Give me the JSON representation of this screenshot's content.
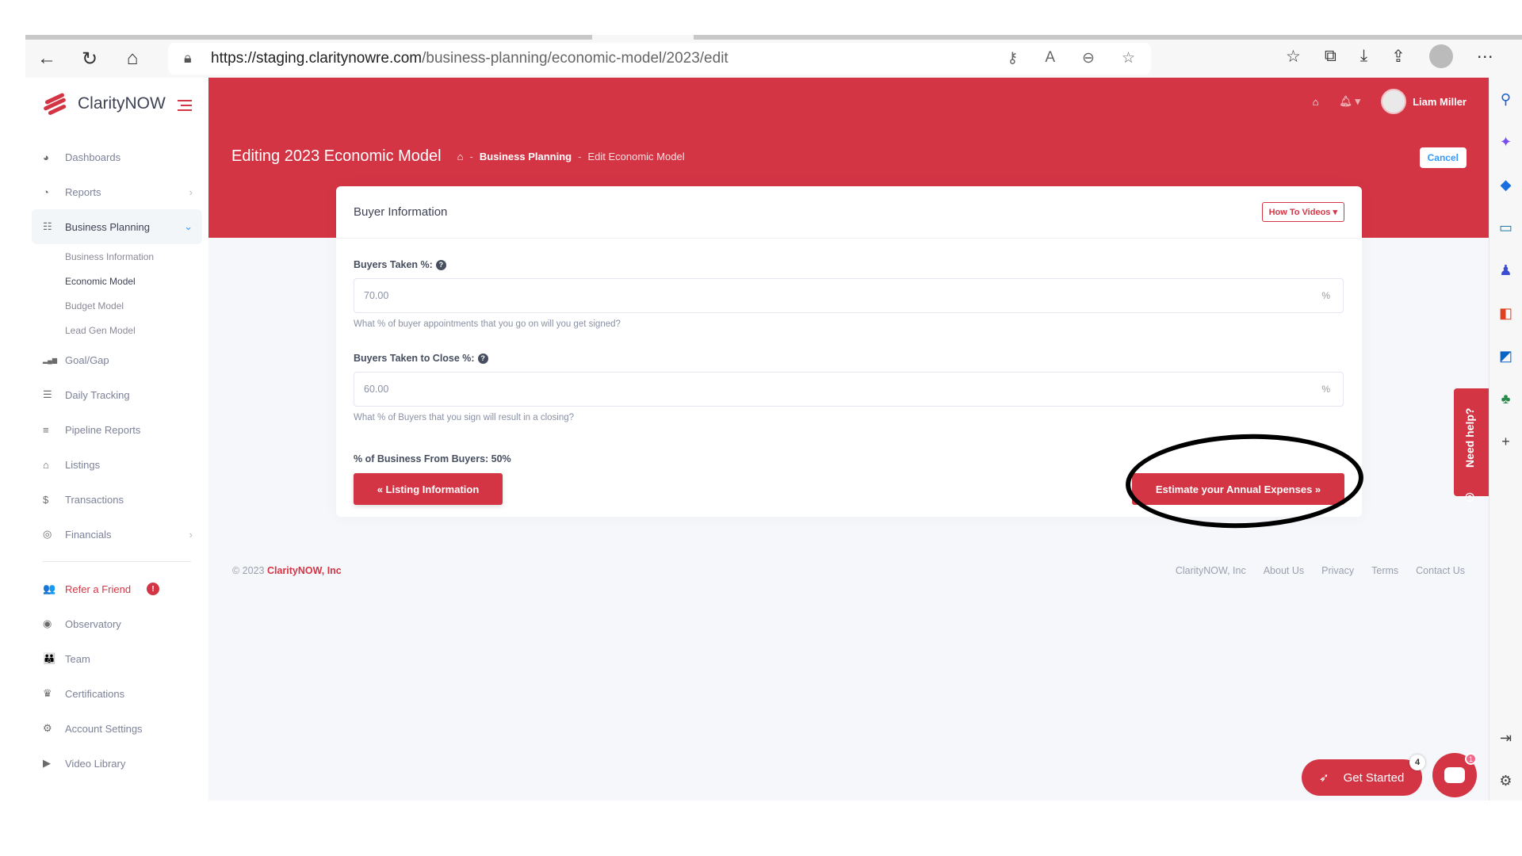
{
  "browser": {
    "url_host": "https://staging.claritynowre.com",
    "url_path": "/business-planning/economic-model/2023/edit",
    "nav_icons": [
      "back-icon",
      "refresh-icon",
      "home-icon"
    ],
    "address_icons": [
      "key-icon",
      "read-aloud-icon",
      "zoom-out-icon",
      "add-favorite-icon"
    ],
    "toolbar_icons": [
      "favorites-icon",
      "collections-icon",
      "downloads-icon",
      "share-icon",
      "profile-icon",
      "more-icon"
    ]
  },
  "app": {
    "brand": "ClarityNOW",
    "user_name": "Liam Miller"
  },
  "sidebar": {
    "items": [
      {
        "label": "Dashboards",
        "icon": "dashboard-icon",
        "glyph": "◕"
      },
      {
        "label": "Reports",
        "icon": "pie-chart-icon",
        "glyph": "◔",
        "chevron": "›"
      },
      {
        "label": "Business Planning",
        "icon": "checklist-icon",
        "glyph": "☷",
        "chevron": "⌄"
      },
      {
        "label": "Goal/Gap",
        "icon": "signal-bars-icon",
        "glyph": "▂▄▆"
      },
      {
        "label": "Daily Tracking",
        "icon": "list-icon",
        "glyph": "☰"
      },
      {
        "label": "Pipeline Reports",
        "icon": "bars-icon",
        "glyph": "≡"
      },
      {
        "label": "Listings",
        "icon": "home-icon",
        "glyph": "⌂"
      },
      {
        "label": "Transactions",
        "icon": "dollar-icon",
        "glyph": "$"
      },
      {
        "label": "Financials",
        "icon": "coins-icon",
        "glyph": "◎",
        "chevron": "›"
      },
      {
        "label": "Refer a Friend",
        "icon": "users-icon",
        "glyph": "👥",
        "badge": "!"
      },
      {
        "label": "Observatory",
        "icon": "eye-icon",
        "glyph": "◉"
      },
      {
        "label": "Team",
        "icon": "team-icon",
        "glyph": "👪"
      },
      {
        "label": "Certifications",
        "icon": "crown-icon",
        "glyph": "♛"
      },
      {
        "label": "Account Settings",
        "icon": "gear-icon",
        "glyph": "⚙"
      },
      {
        "label": "Video Library",
        "icon": "play-icon",
        "glyph": "▶"
      }
    ],
    "sub_items": [
      "Business Information",
      "Economic Model",
      "Budget Model",
      "Lead Gen Model"
    ],
    "active_sub": "Economic Model"
  },
  "header": {
    "title": "Editing 2023 Economic Model",
    "breadcrumb": [
      "Business Planning",
      "Edit Economic Model"
    ],
    "cancel_label": "Cancel"
  },
  "card": {
    "title": "Buyer Information",
    "how_to_label": "How To Videos ▾",
    "fields": [
      {
        "label": "Buyers Taken %:",
        "value": "70.00",
        "suffix": "%",
        "help": "What % of buyer appointments that you go on will you get signed?"
      },
      {
        "label": "Buyers Taken to Close %:",
        "value": "60.00",
        "suffix": "%",
        "help": "What % of Buyers that you sign will result in a closing?"
      }
    ],
    "summary": "% of Business From Buyers: 50%",
    "prev_label": "« Listing Information",
    "next_label": "Estimate your Annual Expenses »"
  },
  "footer": {
    "copyright": "© 2023",
    "brand": "ClarityNOW, Inc",
    "links": [
      "ClarityNOW, Inc",
      "About Us",
      "Privacy",
      "Terms",
      "Contact Us"
    ]
  },
  "widgets": {
    "need_help": "Need help?",
    "get_started": "Get Started",
    "get_started_count": "4",
    "chat_count": "1"
  },
  "edge_sidebar": [
    "search-icon",
    "copilot-icon",
    "shopping-tag-icon",
    "tools-icon",
    "games-icon",
    "office-icon",
    "outlook-icon",
    "tree-icon",
    "add-icon"
  ]
}
